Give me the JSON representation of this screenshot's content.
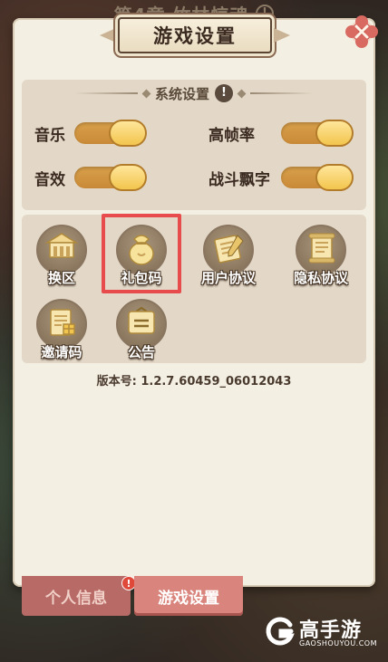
{
  "background": {
    "chapter_title": "第4章  竹林惊魂"
  },
  "dialog": {
    "title": "游戏设置",
    "close_icon": "close-icon"
  },
  "system_settings": {
    "heading": "系统设置",
    "info_icon": "info-icon",
    "toggles": [
      {
        "label": "音乐",
        "state": "on"
      },
      {
        "label": "高帧率",
        "state": "on"
      },
      {
        "label": "音效",
        "state": "on"
      },
      {
        "label": "战斗飘字",
        "state": "on"
      }
    ]
  },
  "actions": [
    {
      "label": "换区",
      "icon": "switch-server-icon"
    },
    {
      "label": "礼包码",
      "icon": "gift-bag-icon",
      "highlighted": true
    },
    {
      "label": "用户协议",
      "icon": "user-agreement-scroll-icon"
    },
    {
      "label": "隐私协议",
      "icon": "privacy-scroll-icon"
    },
    {
      "label": "邀请码",
      "icon": "invite-code-icon"
    },
    {
      "label": "公告",
      "icon": "announcement-icon"
    }
  ],
  "version_text": "版本号: 1.2.7.60459_06012043",
  "tabs": [
    {
      "label": "个人信息",
      "active": false,
      "badge": "!"
    },
    {
      "label": "游戏设置",
      "active": true
    }
  ],
  "watermark": {
    "brand": "高手游",
    "domain": "GAOSHOUYOU.COM"
  },
  "colors": {
    "panel": "#f4efe3",
    "section_bg": "#e3d8c7",
    "toggle_on": "#f2c54e",
    "highlight": "#e74b4b",
    "tab_active": "#d9847c",
    "tab_inactive": "#b86a66"
  }
}
